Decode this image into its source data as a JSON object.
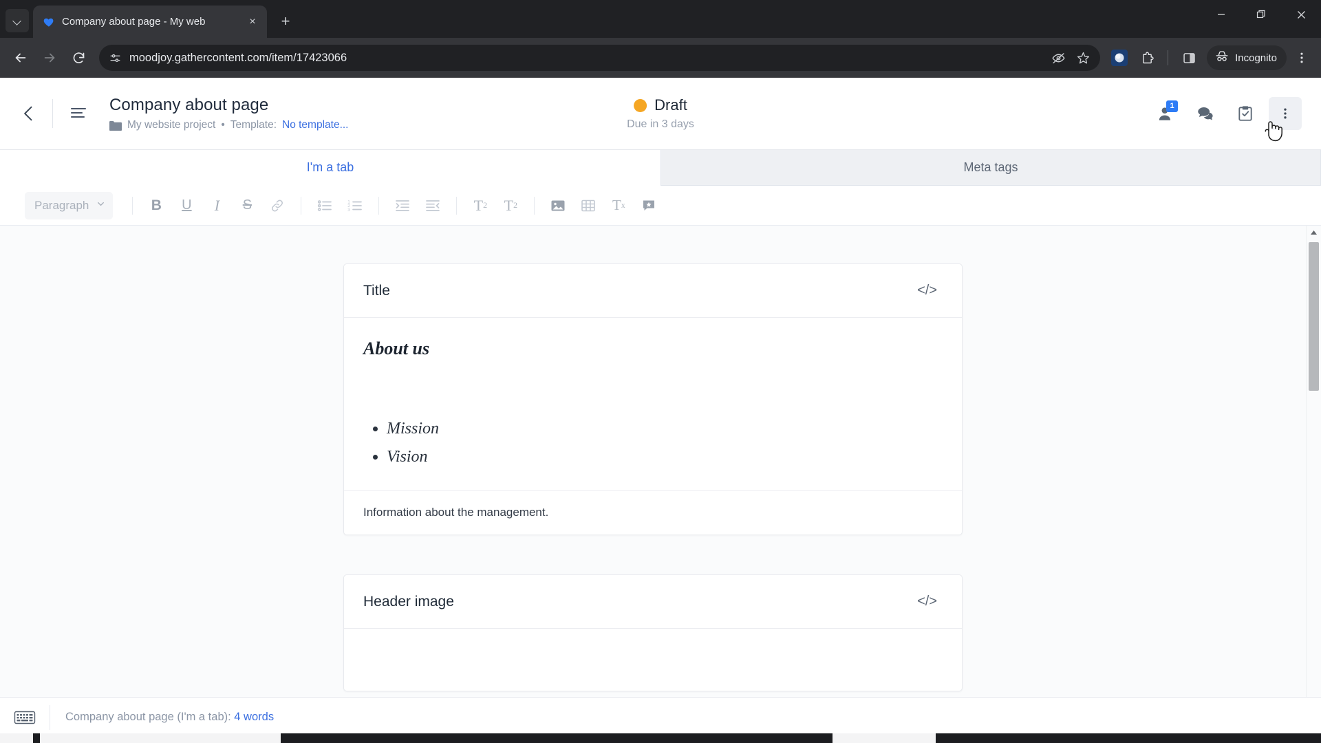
{
  "browser": {
    "tab": {
      "title": "Company about page - My web",
      "favicon": "gathercontent-heart-icon",
      "close": "×",
      "search_tabs": "tab-search-icon"
    },
    "new_tab_label": "+",
    "window_controls": {
      "minimize": "minimize-icon",
      "maximize": "maximize-icon",
      "close": "close-icon"
    },
    "nav": {
      "back": "back-arrow-icon",
      "forward": "forward-arrow-icon",
      "reload": "reload-icon"
    },
    "omnibox": {
      "url": "moodjoy.gathercontent.com/item/17423066",
      "site_settings_icon": "site-settings-icon",
      "tracking_protection_icon": "eye-crossed-icon",
      "bookmark_icon": "star-icon"
    },
    "toolbar": {
      "profile_icon": "profile-avatar-icon",
      "extensions_icon": "extensions-puzzle-icon",
      "side_panel_icon": "side-panel-icon",
      "incognito_label": "Incognito",
      "incognito_icon": "incognito-hat-icon",
      "menu_icon": "three-dot-menu-icon"
    }
  },
  "app_header": {
    "back_icon": "chevron-left-icon",
    "menu_icon": "list-menu-icon",
    "title": "Company about page",
    "folder_icon": "folder-icon",
    "project": "My website project",
    "separator": "•",
    "template_label": "Template:",
    "template_value": "No template...",
    "status": {
      "label": "Draft",
      "dot_color": "#f5a623",
      "due": "Due in 3 days"
    },
    "actions": [
      {
        "name": "assignee",
        "icon": "person-icon",
        "badge": "1"
      },
      {
        "name": "comments",
        "icon": "chat-bubble-icon",
        "badge": ""
      },
      {
        "name": "checklist",
        "icon": "clipboard-check-icon",
        "badge": ""
      },
      {
        "name": "more-options",
        "icon": "vertical-dots-icon",
        "badge": ""
      }
    ]
  },
  "tabs": [
    {
      "label": "I'm a tab",
      "selected": true
    },
    {
      "label": "Meta tags",
      "selected": false
    }
  ],
  "editor_toolbar": {
    "paragraph_label": "Paragraph",
    "paragraph_caret": "chevron-down-icon",
    "buttons": [
      {
        "name": "bold",
        "glyph": "B"
      },
      {
        "name": "underline",
        "glyph": "U"
      },
      {
        "name": "italic",
        "glyph": "I"
      },
      {
        "name": "strikethrough",
        "glyph": "S"
      },
      {
        "name": "link",
        "glyph": "link-icon"
      },
      {
        "name": "bulleted-list",
        "glyph": "bullet-list-icon"
      },
      {
        "name": "numbered-list",
        "glyph": "numbered-list-icon"
      },
      {
        "name": "indent",
        "glyph": "indent-icon"
      },
      {
        "name": "outdent",
        "glyph": "outdent-icon"
      },
      {
        "name": "subscript",
        "glyph": "T2"
      },
      {
        "name": "superscript",
        "glyph": "T1"
      },
      {
        "name": "insert-image",
        "glyph": "image-icon"
      },
      {
        "name": "insert-table",
        "glyph": "table-icon"
      },
      {
        "name": "clear-formatting",
        "glyph": "Tx"
      },
      {
        "name": "add-comment",
        "glyph": "comment-star-icon"
      }
    ]
  },
  "content": {
    "cards": [
      {
        "title": "Title",
        "code_icon": "</>",
        "heading": "About us",
        "list": [
          "Mission",
          "Vision"
        ],
        "footnote": "Information about the management."
      },
      {
        "title": "Header image",
        "code_icon": "</>",
        "heading": "",
        "list": [],
        "footnote": ""
      }
    ]
  },
  "statusbar": {
    "keyboard_icon": "keyboard-icon",
    "text_prefix": "Company about page (I'm a tab):",
    "wordcount": "4 words"
  },
  "colors": {
    "accent_blue": "#3b6fe0",
    "status_orange": "#f5a623",
    "chrome_dark": "#202124",
    "chrome_toolbar": "#35363a"
  }
}
